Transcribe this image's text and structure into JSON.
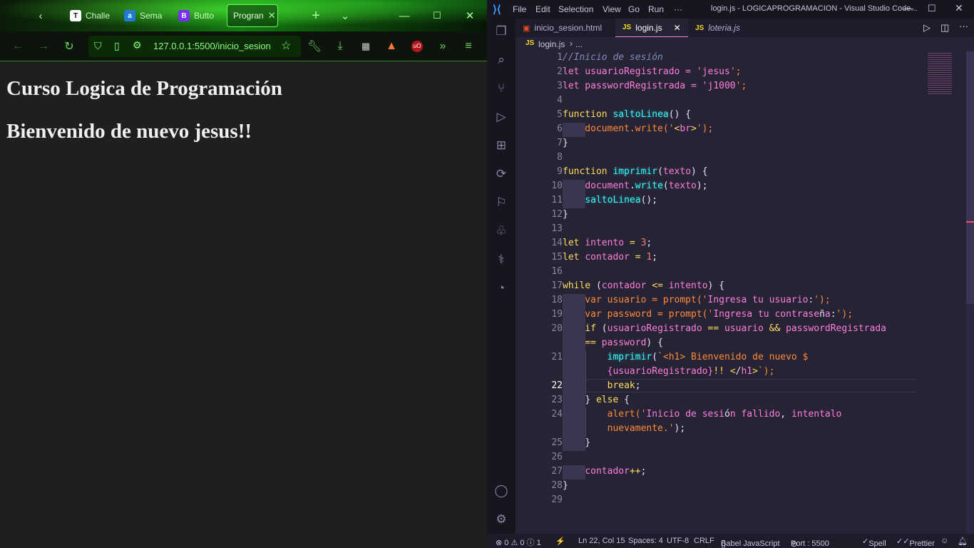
{
  "browser": {
    "tabs": [
      {
        "label": "Challe",
        "fav": "T",
        "favbg": "#ffffff",
        "favfg": "#111111"
      },
      {
        "label": "Sema",
        "fav": "a",
        "favbg": "#1f7bd8",
        "favfg": "#ffffff"
      },
      {
        "label": "Butto",
        "fav": "B",
        "favbg": "#7a2ff7",
        "favfg": "#ffffff"
      },
      {
        "label": "Progran",
        "fav": "",
        "favbg": "",
        "favfg": ""
      }
    ],
    "url": "127.0.0.1:5500/inicio_sesion",
    "page": {
      "heading1": "Curso Logica de Programación",
      "heading2": "Bienvenido de nuevo jesus!!"
    }
  },
  "vscode": {
    "menu": [
      "File",
      "Edit",
      "Selection",
      "View",
      "Go",
      "Run",
      "···"
    ],
    "title": "login.js - LOGICAPROGRAMACION - Visual Studio Code...",
    "tabs": [
      {
        "label": "inicio_sesion.html",
        "type": "html"
      },
      {
        "label": "login.js",
        "type": "js"
      },
      {
        "label": "loteria.js",
        "type": "js"
      }
    ],
    "breadcrumb": {
      "file": "login.js",
      "more": "..."
    },
    "line_numbers": [
      "1",
      "2",
      "3",
      "4",
      "5",
      "6",
      "7",
      "8",
      "9",
      "10",
      "11",
      "12",
      "13",
      "14",
      "15",
      "16",
      "17",
      "18",
      "19",
      "20",
      "21",
      "22",
      "23",
      "24",
      "25",
      "26",
      "27",
      "28",
      "29"
    ],
    "code": [
      "//Inicio de sesión",
      "let usuarioRegistrado = 'jesus';",
      "let passwordRegistrada = 'j1000';",
      "",
      "function saltoLinea() {",
      "    document.write('<br>');",
      "}",
      "",
      "function imprimir(texto) {",
      "    document.write(texto);",
      "    saltoLinea();",
      "}",
      "",
      "let intento = 3;",
      "let contador = 1;",
      "",
      "while (contador <= intento) {",
      "    var usuario = prompt('Ingresa tu usuario:');",
      "    var password = prompt('Ingresa tu contraseña:');",
      "    if (usuarioRegistrado == usuario && passwordRegistrada",
      "    == password) {",
      "        imprimir(`<h1> Bienvenido de nuevo $",
      "        {usuarioRegistrado}!! </h1>`);",
      "        break;",
      "    } else {",
      "        alert('Inicio de sesión fallido, intentalo",
      "        nuevamente.');",
      "    }",
      "",
      "    contador++;",
      "}",
      ""
    ],
    "status": {
      "errors": "0",
      "warnings": "0",
      "info": "1",
      "position": "Ln 22, Col 15",
      "spaces": "Spaces: 4",
      "encoding": "UTF-8",
      "eol": "CRLF",
      "language": "Babel JavaScript",
      "port": "Port : 5500",
      "spell": "Spell",
      "prettier": "Prettier"
    },
    "colors": {
      "keyword": "#fede5d",
      "variable": "#ff7edb",
      "string": "#ff8b39",
      "function": "#36f9f6",
      "number": "#f97e72",
      "comment": "#848bbd"
    }
  }
}
